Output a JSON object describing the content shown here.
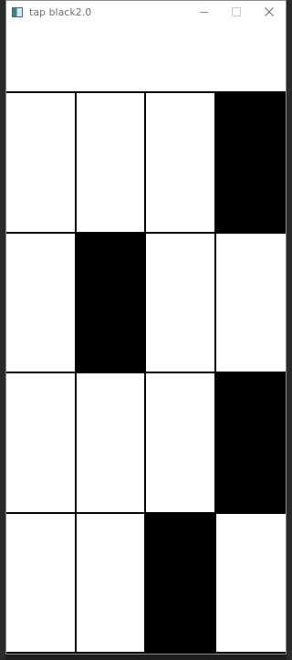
{
  "window": {
    "title": "tap black2.0"
  },
  "board": {
    "rows": [
      [
        "white",
        "white",
        "white",
        "black"
      ],
      [
        "white",
        "black",
        "white",
        "white"
      ],
      [
        "white",
        "white",
        "white",
        "black"
      ],
      [
        "white",
        "white",
        "black",
        "white"
      ]
    ]
  },
  "icons": {
    "app": "app-window-icon",
    "minimize": "minimize-icon",
    "maximize": "maximize-icon",
    "close": "close-icon"
  }
}
